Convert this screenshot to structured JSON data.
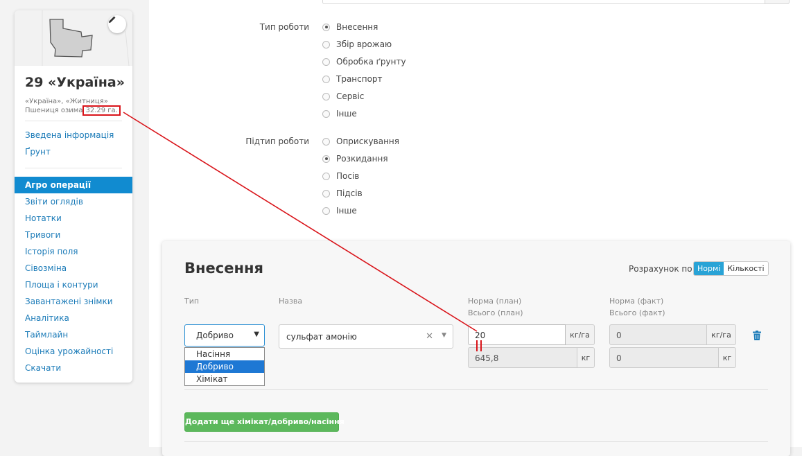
{
  "field": {
    "title": "29 «Україна»",
    "owners": "«Україна», «Житниця»",
    "crop": "Пшениця озима",
    "area": "32.29 га."
  },
  "nav": {
    "top": [
      "Зведена інформація",
      "Ґрунт"
    ],
    "active": "Агро операції",
    "items": [
      "Звіти оглядів",
      "Нотатки",
      "Тривоги",
      "Історія поля",
      "Сівозміна",
      "Площа і контури",
      "Завантажені знімки",
      "Аналітика",
      "Таймлайн",
      "Оцінка урожайності",
      "Скачати"
    ]
  },
  "work_type": {
    "label": "Тип роботи",
    "options": [
      "Внесення",
      "Збір врожаю",
      "Обробка ґрунту",
      "Транспорт",
      "Сервіс",
      "Інше"
    ],
    "selected": 0
  },
  "work_subtype": {
    "label": "Підтип роботи",
    "options": [
      "Оприскування",
      "Розкидання",
      "Посів",
      "Підсів",
      "Інше"
    ],
    "selected": 1
  },
  "card": {
    "title": "Внесення",
    "calc_label": "Розрахунок по",
    "calc_options": [
      "Нормі",
      "Кількості"
    ],
    "col_type": "Тип",
    "col_name": "Назва",
    "col_norm_plan": "Норма (план)",
    "col_total_plan": "Всього (план)",
    "col_norm_fact": "Норма (факт)",
    "col_total_fact": "Всього (факт)",
    "type_value": "Добриво",
    "type_options": [
      "Насіння",
      "Добриво",
      "Хімікат"
    ],
    "type_selected": 1,
    "name_value": "сульфат амонію",
    "norm_plan": "20",
    "norm_plan_unit": "кг/га",
    "total_plan": "645,8",
    "total_plan_unit": "кг",
    "norm_fact": "0",
    "norm_fact_unit": "кг/га",
    "total_fact": "0",
    "total_fact_unit": "кг",
    "add_button": "Додати ще хімікат/добриво/насіння"
  },
  "colors": {
    "accent": "#118bd0",
    "annotation": "#d9141a",
    "add_button": "#5cb85c"
  }
}
